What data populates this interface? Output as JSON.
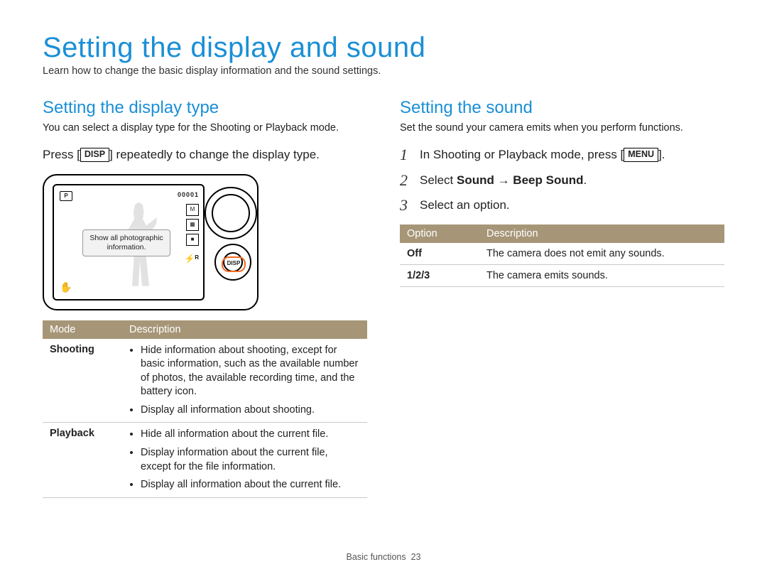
{
  "page_title": "Setting the display and sound",
  "page_sub": "Learn how to change the basic display information and the sound settings.",
  "left": {
    "heading": "Setting the display type",
    "lede": "You can select a display type for the Shooting or Playback mode.",
    "instr_pre": "Press [",
    "instr_key": "DISP",
    "instr_post": "] repeatedly to change the display type.",
    "callout": "Show all photographic information.",
    "osd_top_right": "00001",
    "osd_icons": [
      "M",
      "▦",
      "■"
    ],
    "osd_flash": "⚡ᴿ",
    "osd_hand": "✋",
    "disp_label": "DISP",
    "table_head": [
      "Mode",
      "Description"
    ],
    "rows": [
      {
        "mode": "Shooting",
        "items": [
          "Hide information about shooting, except for basic information, such as the available number of photos, the available recording time, and the battery icon.",
          "Display all information about shooting."
        ]
      },
      {
        "mode": "Playback",
        "items": [
          "Hide all information about the current file.",
          "Display information about the current file, except for the file information.",
          "Display all information about the current file."
        ]
      }
    ]
  },
  "right": {
    "heading": "Setting the sound",
    "lede": "Set the sound your camera emits when you perform functions.",
    "steps": [
      {
        "pre": "In Shooting or Playback mode, press [",
        "key": "MENU",
        "post": "]."
      },
      {
        "pre": "Select ",
        "bold": "Sound → Beep Sound",
        "post": "."
      },
      {
        "pre": "Select an option.",
        "bold": "",
        "post": ""
      }
    ],
    "table_head": [
      "Option",
      "Description"
    ],
    "rows": [
      {
        "opt": "Off",
        "desc": "The camera does not emit any sounds."
      },
      {
        "opt": "1/2/3",
        "desc": "The camera emits sounds."
      }
    ]
  },
  "footer_section": "Basic functions",
  "footer_page": "23"
}
